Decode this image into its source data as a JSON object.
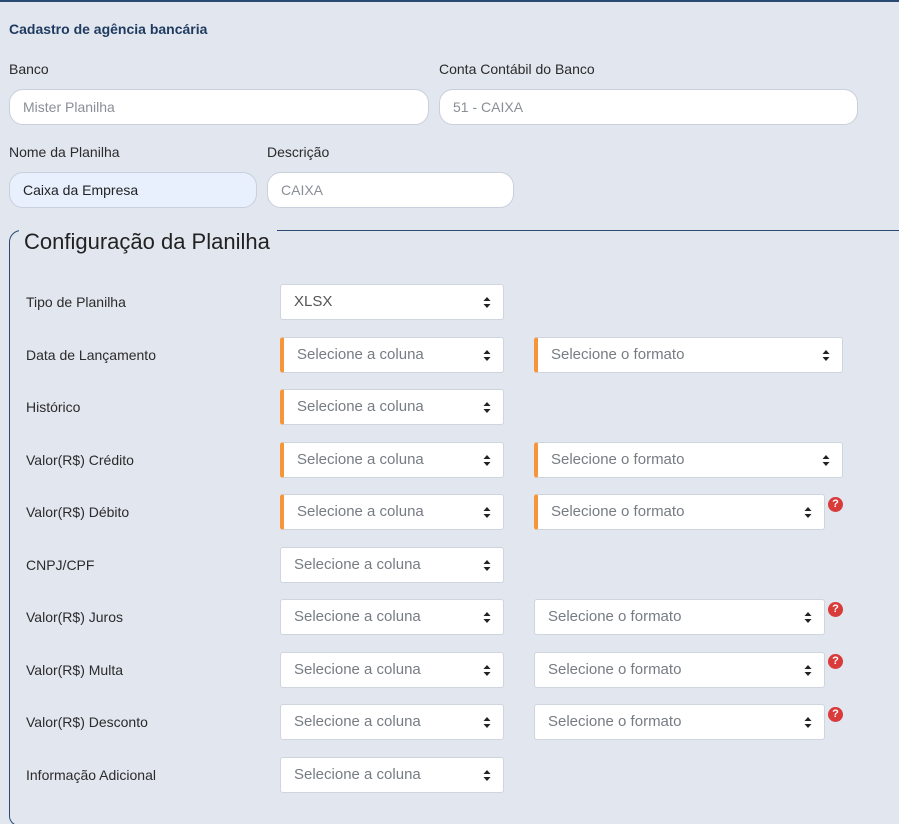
{
  "form": {
    "title": "Cadastro de agência bancária",
    "bank_label": "Banco",
    "bank_placeholder": "Mister Planilha",
    "account_label": "Conta Contábil do Banco",
    "account_value": "51 - CAIXA",
    "sheet_name_label": "Nome da Planilha",
    "sheet_name_value": "Caixa da Empresa",
    "description_label": "Descrição",
    "description_value": "CAIXA"
  },
  "config": {
    "legend": "Configuração da Planilha",
    "sheet_type": {
      "label": "Tipo de Planilha",
      "value": "XLSX"
    },
    "rows": [
      {
        "label": "Data de Lançamento",
        "column": "Selecione a coluna",
        "format": "Selecione o formato"
      },
      {
        "label": "Histórico",
        "column": "Selecione a coluna"
      },
      {
        "label": "Valor(R$) Crédito",
        "column": "Selecione a coluna",
        "format": "Selecione o formato"
      },
      {
        "label": "Valor(R$) Débito",
        "column": "Selecione a coluna",
        "format": "Selecione o formato",
        "help": "?"
      },
      {
        "label": "CNPJ/CPF",
        "column": "Selecione a coluna"
      },
      {
        "label": "Valor(R$) Juros",
        "column": "Selecione a coluna",
        "format": "Selecione o formato",
        "help": "?"
      },
      {
        "label": "Valor(R$) Multa",
        "column": "Selecione a coluna",
        "format": "Selecione o formato",
        "help": "?"
      },
      {
        "label": "Valor(R$) Desconto",
        "column": "Selecione a coluna",
        "format": "Selecione o formato",
        "help": "?"
      },
      {
        "label": "Informação Adicional",
        "column": "Selecione a coluna"
      }
    ]
  },
  "colors": {
    "required_accent": "#f7953b",
    "help_icon": "#d93a3a",
    "title": "#1f3a5f"
  }
}
